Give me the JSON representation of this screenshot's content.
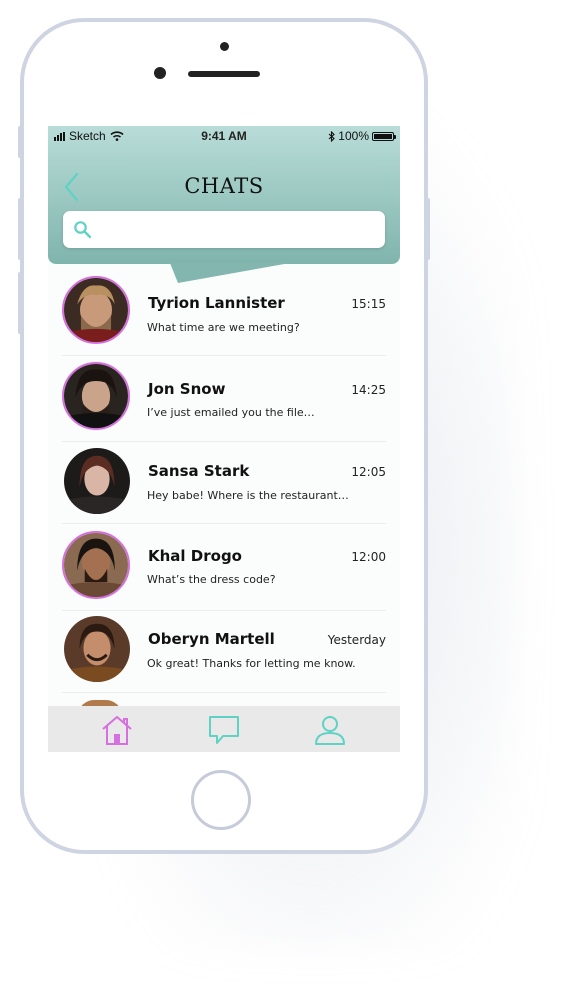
{
  "status_bar": {
    "carrier": "Sketch",
    "time": "9:41 AM",
    "battery": "100%"
  },
  "header": {
    "title": "CHATS",
    "search_placeholder": ""
  },
  "chats": [
    {
      "name": "Tyrion Lannister",
      "time": "15:15",
      "message": "What time are we meeting?",
      "avatar_ring": true
    },
    {
      "name": "Jon Snow",
      "time": "14:25",
      "message": "I’ve just emailed you the file…",
      "avatar_ring": true
    },
    {
      "name": "Sansa Stark",
      "time": "12:05",
      "message": "Hey babe! Where is the restaurant…",
      "avatar_ring": false
    },
    {
      "name": "Khal Drogo",
      "time": "12:00",
      "message": "What’s the dress code?",
      "avatar_ring": true
    },
    {
      "name": "Oberyn Martell",
      "time": "Yesterday",
      "message": "Ok great! Thanks for letting me know.",
      "avatar_ring": false
    }
  ],
  "tabs": [
    {
      "icon": "home-icon",
      "active": true
    },
    {
      "icon": "chat-bubble-icon",
      "active": false
    },
    {
      "icon": "profile-icon",
      "active": false
    }
  ],
  "colors": {
    "accent_teal": "#7fb4ad",
    "icon_teal": "#5fd2c4",
    "active_pink": "#d66fe0",
    "phone_frame": "#cfd4e3"
  }
}
